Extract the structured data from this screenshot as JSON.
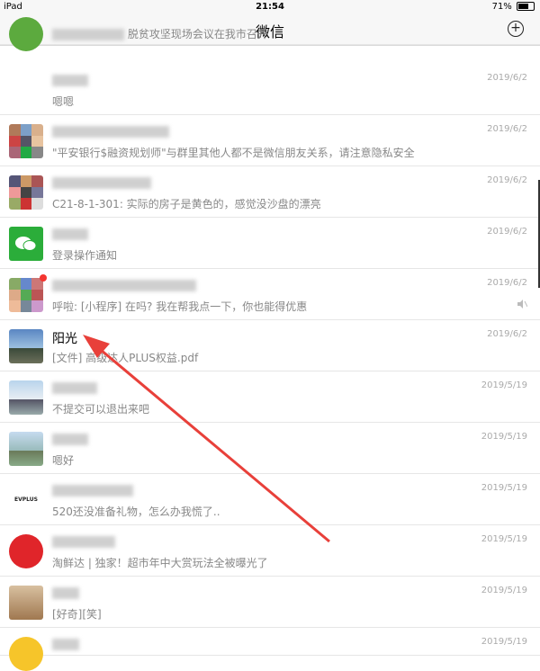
{
  "status_bar": {
    "device": "iPad",
    "time": "21:54",
    "battery": "71%"
  },
  "navbar": {
    "title": "微信",
    "add_icon": "plus-circle-icon"
  },
  "chats": [
    {
      "name": "",
      "message": "脱贫攻坚现场会议在我市召开",
      "time": "",
      "avatar": "green-logo"
    },
    {
      "name": "",
      "message": "嗯嗯",
      "time": "2019/6/2",
      "avatar": "blank"
    },
    {
      "name": "",
      "message": "\"平安银行$融资规划师\"与群里其他人都不是微信朋友关系，请注意隐私安全",
      "time": "2019/6/2",
      "avatar": "group-grid"
    },
    {
      "name": "",
      "message": "C21-8-1-301: 实际的房子是黄色的，感觉没沙盘的漂亮",
      "time": "2019/6/2",
      "avatar": "group-grid"
    },
    {
      "name": "",
      "message": "登录操作通知",
      "time": "2019/6/2",
      "avatar": "wechat-green"
    },
    {
      "name": "",
      "message": "呼啦: [小程序] 在吗? 我在帮我点一下，你也能得优惠",
      "time": "2019/6/2",
      "avatar": "group-grid",
      "unread": true,
      "muted": true
    },
    {
      "name": "阳光",
      "message": "[文件] 高级达人PLUS权益.pdf",
      "time": "2019/6/2",
      "avatar": "sky-photo"
    },
    {
      "name": "",
      "message": "不提交可以退出来吧",
      "time": "2019/5/19",
      "avatar": "person-photo"
    },
    {
      "name": "",
      "message": "嗯好",
      "time": "2019/5/19",
      "avatar": "person-photo"
    },
    {
      "name": "",
      "message": "520还没准备礼物，怎么办我慌了..",
      "time": "2019/5/19",
      "avatar": "evplus-logo"
    },
    {
      "name": "",
      "message": "淘鲜达 | 独家！超市年中大赏玩法全被曝光了",
      "time": "2019/5/19",
      "avatar": "red-logo"
    },
    {
      "name": "",
      "message": "[好奇][笑]",
      "time": "2019/5/19",
      "avatar": "person-photo"
    },
    {
      "name": "",
      "message": "",
      "time": "2019/5/19",
      "avatar": "yellow-cartoon"
    }
  ],
  "colors": {
    "arrow": "#e8403a",
    "wechat_green": "#2bad3a"
  }
}
